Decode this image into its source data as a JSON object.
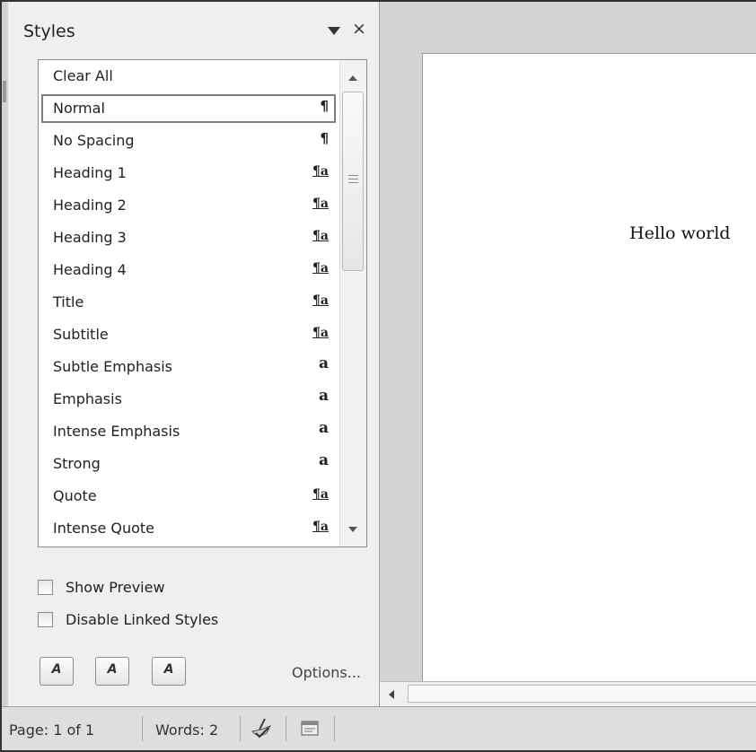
{
  "pane": {
    "title": "Styles",
    "dropdown_icon": "triangle-down-icon",
    "close_glyph": "×"
  },
  "styles_list": {
    "items": [
      {
        "label": "Clear All",
        "icon": ""
      },
      {
        "label": "Normal",
        "icon": "¶",
        "selected": true
      },
      {
        "label": "No Spacing",
        "icon": "¶"
      },
      {
        "label": "Heading 1",
        "icon": "¶a"
      },
      {
        "label": "Heading 2",
        "icon": "¶a"
      },
      {
        "label": "Heading 3",
        "icon": "¶a"
      },
      {
        "label": "Heading 4",
        "icon": "¶a"
      },
      {
        "label": "Title",
        "icon": "¶a"
      },
      {
        "label": "Subtitle",
        "icon": "¶a"
      },
      {
        "label": "Subtle Emphasis",
        "icon": "a"
      },
      {
        "label": "Emphasis",
        "icon": "a"
      },
      {
        "label": "Intense Emphasis",
        "icon": "a"
      },
      {
        "label": "Strong",
        "icon": "a"
      },
      {
        "label": "Quote",
        "icon": "¶a"
      },
      {
        "label": "Intense Quote",
        "icon": "¶a"
      }
    ]
  },
  "options": {
    "show_preview": "Show Preview",
    "show_preview_checked": false,
    "disable_linked_styles": "Disable Linked Styles",
    "disable_linked_styles_checked": false
  },
  "pane_buttons": {
    "new_style": "A",
    "style_inspector": "A",
    "manage_styles": "A",
    "options_link": "Options..."
  },
  "document": {
    "text": "Hello world"
  },
  "statusbar": {
    "page": "Page: 1 of 1",
    "words": "Words: 2"
  }
}
